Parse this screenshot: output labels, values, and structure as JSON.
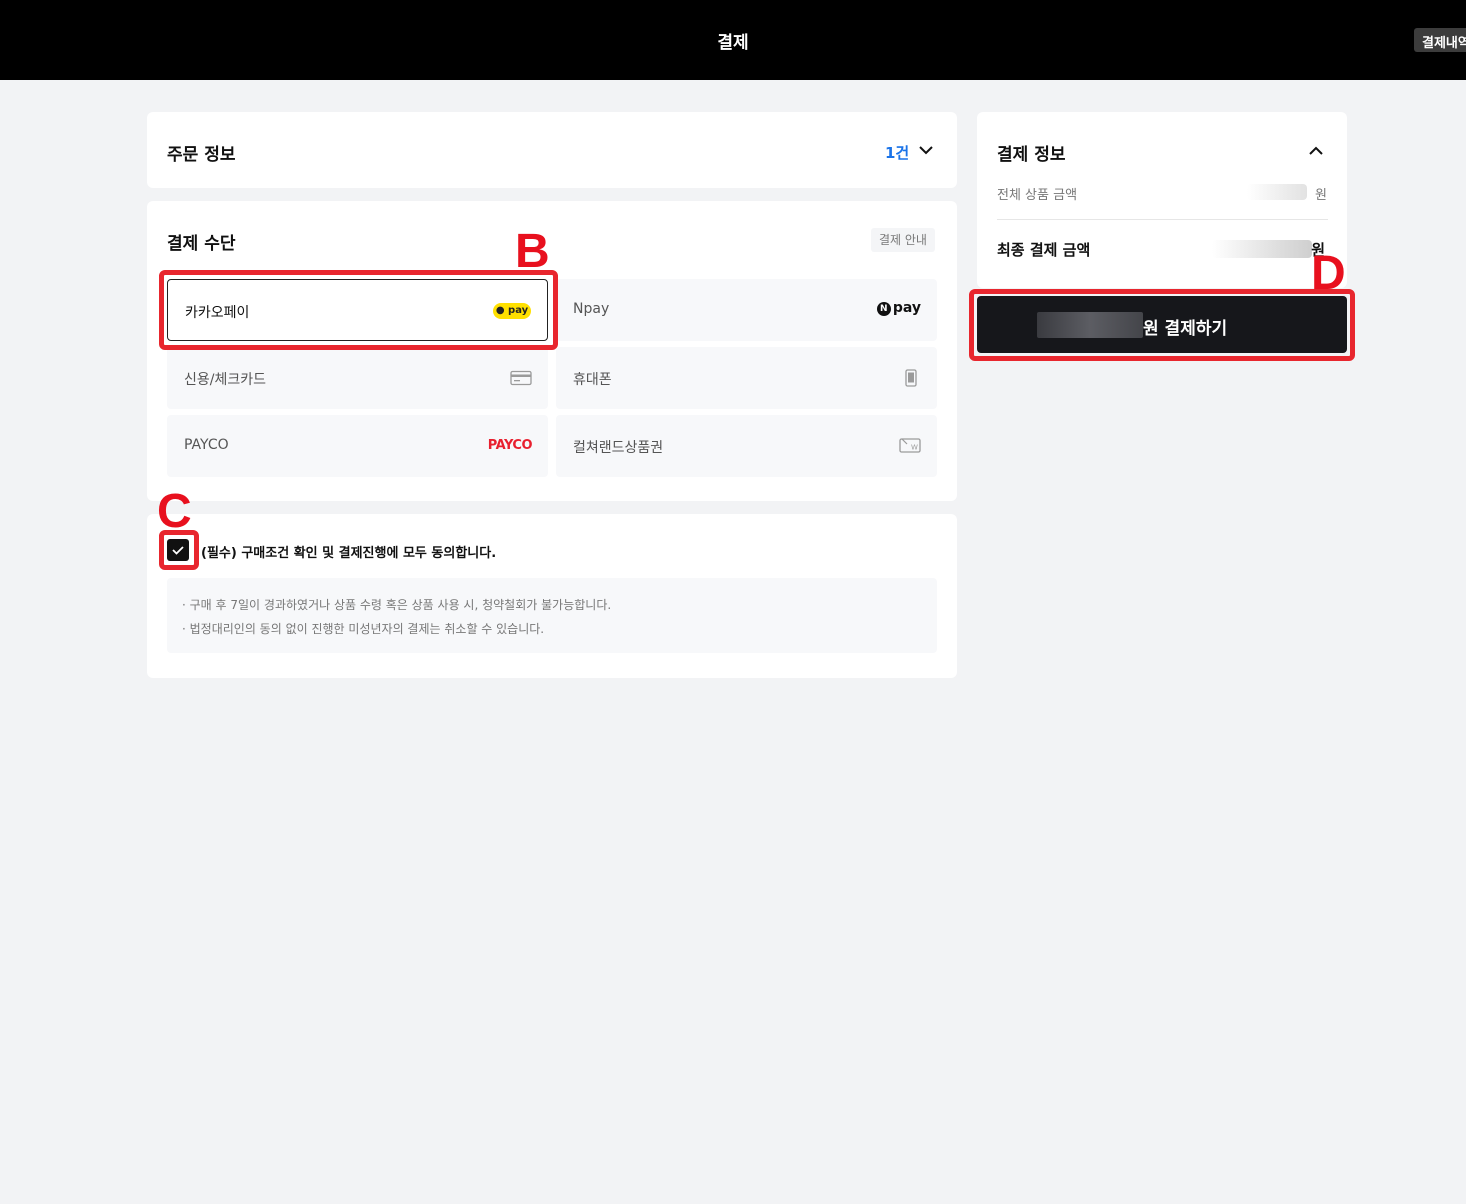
{
  "header": {
    "title": "결제",
    "history_label": "결제내역"
  },
  "order": {
    "title": "주문 정보",
    "count": "1건"
  },
  "payment_method": {
    "title": "결제 수단",
    "guide_label": "결제 안내",
    "options": [
      {
        "label": "카카오페이",
        "icon": "kakaopay-logo",
        "icon_text": "pay",
        "selected": true
      },
      {
        "label": "Npay",
        "icon": "npay-logo",
        "icon_text": "pay",
        "icon_letter": "N",
        "selected": false
      },
      {
        "label": "신용/체크카드",
        "icon": "credit-card-icon",
        "selected": false
      },
      {
        "label": "휴대폰",
        "icon": "mobile-phone-icon",
        "selected": false
      },
      {
        "label": "PAYCO",
        "icon": "payco-logo",
        "icon_text": "PAYCO",
        "selected": false
      },
      {
        "label": "컬쳐랜드상품권",
        "icon": "gift-card-icon",
        "icon_text": "W",
        "selected": false
      }
    ]
  },
  "agreement": {
    "checked": true,
    "text": "(필수) 구매조건 확인 및 결제진행에 모두 동의합니다.",
    "notices": [
      "· 구매 후 7일이 경과하였거나 상품 수령 혹은 상품 사용 시, 청약철회가 불가능합니다.",
      "· 법정대리인의 동의 없이 진행한 미성년자의 결제는 취소할 수 있습니다."
    ]
  },
  "payment_info": {
    "title": "결제 정보",
    "total_label": "전체 상품 금액",
    "total_unit": "원",
    "final_label": "최종 결제 금액",
    "final_unit": "원"
  },
  "pay_button": {
    "label": "원 결제하기"
  },
  "annotations": {
    "b": "B",
    "c": "C",
    "d": "D"
  },
  "colors": {
    "header_bg": "#000000",
    "accent_blue": "#1a73e8",
    "annotation_red": "#e8262e",
    "pay_button_bg": "#16171b",
    "kakao_yellow": "#ffe000",
    "payco_red": "#e8202f"
  }
}
